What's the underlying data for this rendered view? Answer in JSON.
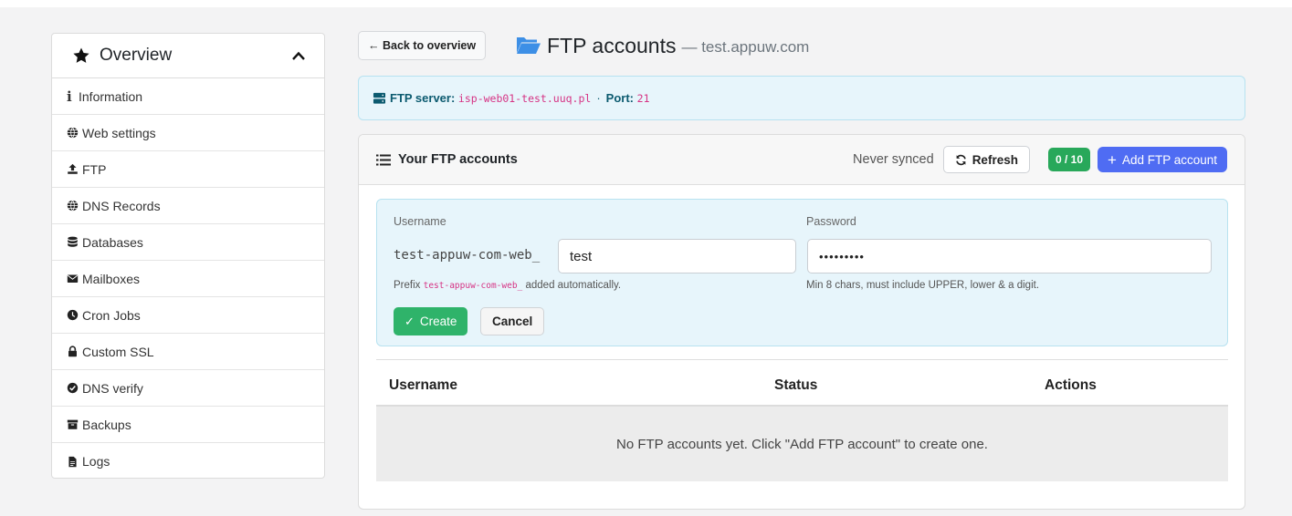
{
  "sidebar": {
    "header": "Overview",
    "items": [
      {
        "label": "Information",
        "icon": "info-icon"
      },
      {
        "label": "Web settings",
        "icon": "globe-icon"
      },
      {
        "label": "FTP",
        "icon": "upload-icon"
      },
      {
        "label": "DNS Records",
        "icon": "globe-icon"
      },
      {
        "label": "Databases",
        "icon": "database-icon"
      },
      {
        "label": "Mailboxes",
        "icon": "envelope-icon"
      },
      {
        "label": "Cron Jobs",
        "icon": "clock-icon"
      },
      {
        "label": "Custom SSL",
        "icon": "lock-icon"
      },
      {
        "label": "DNS verify",
        "icon": "check-circle-icon"
      },
      {
        "label": "Backups",
        "icon": "archive-icon"
      },
      {
        "label": "Logs",
        "icon": "file-icon"
      }
    ]
  },
  "topbar": {
    "back_label": "← Back to overview",
    "title": "FTP accounts",
    "subtitle": "— test.appuw.com"
  },
  "server_info": {
    "server_label": "FTP server:",
    "server_value": "isp-web01-test.uuq.pl",
    "separator": "·",
    "port_label": "Port:",
    "port_value": "21"
  },
  "card": {
    "title": "Your FTP accounts",
    "sync_status": "Never synced",
    "refresh_label": "Refresh",
    "count": "0 / 10",
    "add_label": "Add FTP account"
  },
  "form": {
    "username_label": "Username",
    "username_prefix": "test-appuw-com-web_",
    "username_value": "test",
    "username_hint_before": "Prefix",
    "username_hint_code": "test-appuw-com-web_",
    "username_hint_after": "added automatically.",
    "password_label": "Password",
    "password_value": "•••••••••",
    "password_hint": "Min 8 chars, must include UPPER, lower & a digit.",
    "create_label": "Create",
    "cancel_label": "Cancel"
  },
  "table": {
    "columns": [
      "Username",
      "Status",
      "Actions"
    ],
    "empty_message": "No FTP accounts yet. Click \"Add FTP account\" to create one."
  },
  "colors": {
    "primary": "#4f6cf3",
    "success": "#28a85a",
    "info_bg": "#e7f5fb",
    "code_pink": "#d63384"
  }
}
